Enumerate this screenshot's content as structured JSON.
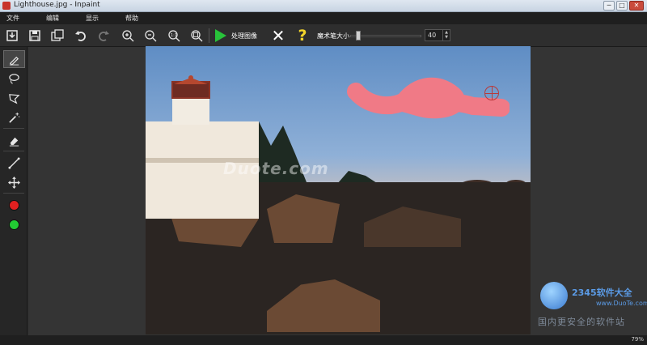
{
  "window": {
    "title": "Lighthouse.jpg - Inpaint",
    "minimize": "─",
    "maximize": "□",
    "close": "✕"
  },
  "menu": [
    "文件",
    "编辑",
    "显示",
    "帮助"
  ],
  "toolbar": {
    "process_label": "处理图像",
    "brush_size_label": "魔术笔大小",
    "brush_size_value": "40",
    "brush_size_level": 0.05
  },
  "canvas": {
    "watermark": "Duote.com",
    "image_file": "Lighthouse.jpg"
  },
  "colors": {
    "mask": "#f07a86",
    "process_green": "#28c23a",
    "help_yellow": "#f2d42a",
    "red_swatch": "#e02020",
    "green_swatch": "#22cc33"
  },
  "brand": {
    "name": "2345软件大全",
    "url": "www.DuoTe.com",
    "slogan": "国内更安全的软件站"
  },
  "status": {
    "zoom": "79%"
  },
  "icons": {
    "toolbar": [
      "open-icon",
      "save-icon",
      "save-as-icon",
      "undo-icon",
      "redo-icon",
      "zoom-in-icon",
      "zoom-out-icon",
      "zoom-actual-icon",
      "zoom-fit-icon"
    ],
    "tools": [
      "marker-icon",
      "lasso-icon",
      "polygon-lasso-icon",
      "magic-wand-icon",
      "eraser-icon",
      "line-icon",
      "move-icon"
    ]
  }
}
